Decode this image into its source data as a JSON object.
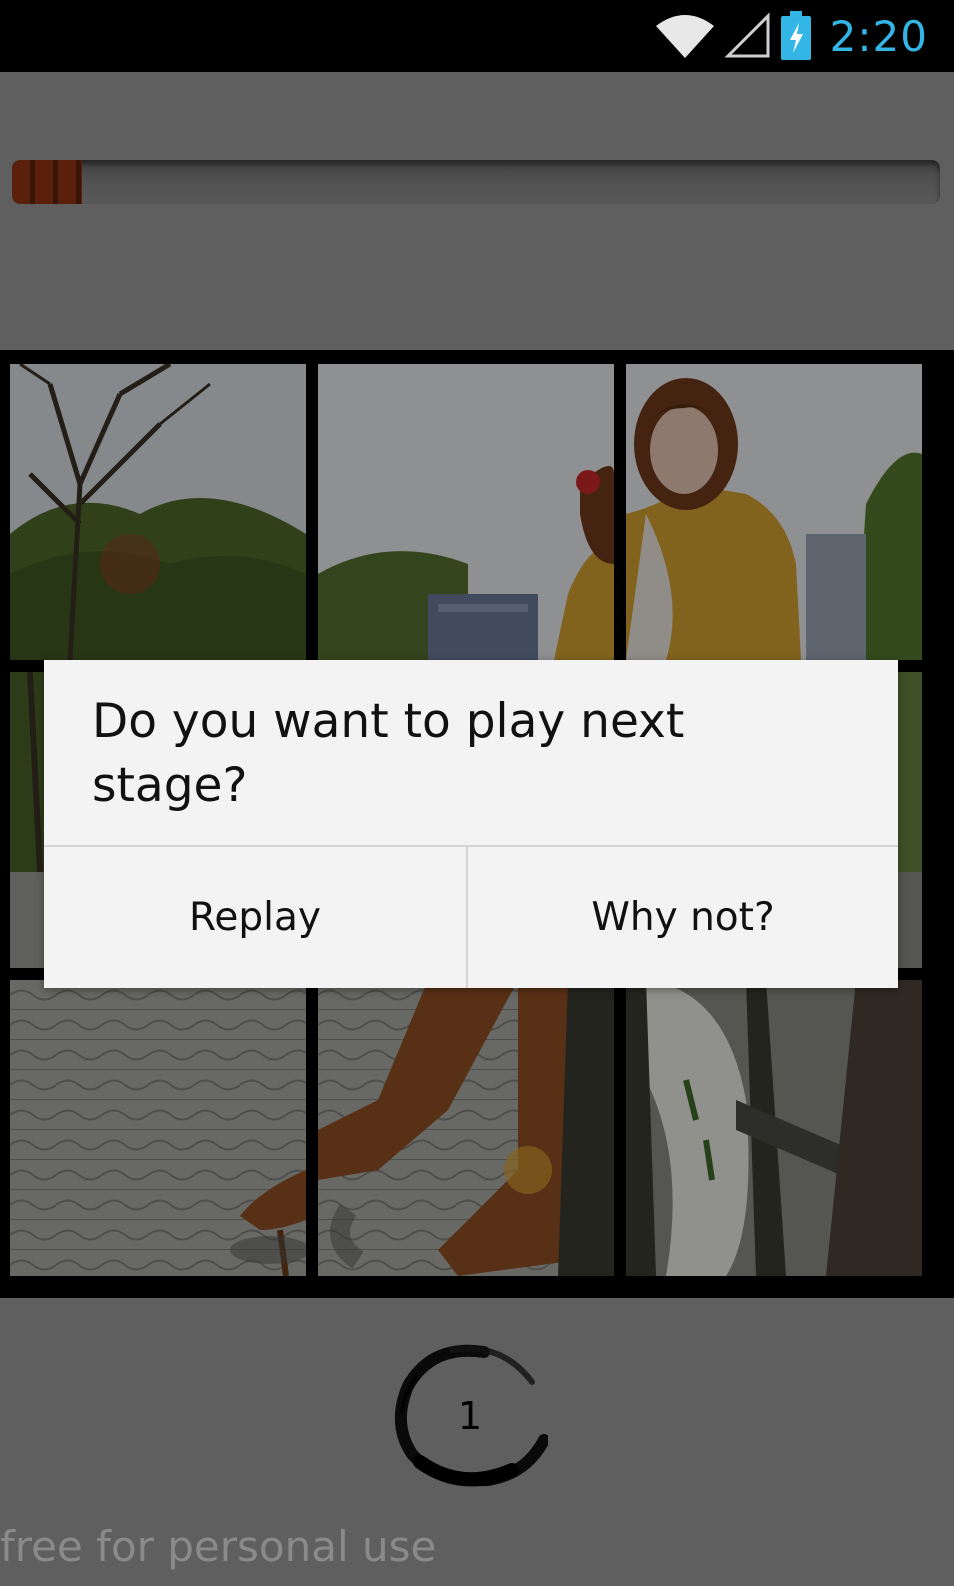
{
  "status_bar": {
    "time": "2:20",
    "icons": [
      "wifi-icon",
      "cell-signal-icon",
      "battery-charging-icon"
    ],
    "time_color": "#33b5e5"
  },
  "progress": {
    "fraction": 0.075,
    "fill_color": "#5a200b"
  },
  "puzzle": {
    "rows": 3,
    "cols": 3,
    "image": "photo-of-woman-in-yellow-jacket-and-brown-boots-in-park"
  },
  "dialog": {
    "message": "Do you want to play next stage?",
    "buttons": {
      "replay": "Replay",
      "next": "Why not?"
    }
  },
  "stage": {
    "number": "1"
  },
  "footer": {
    "text": "free for personal use"
  }
}
